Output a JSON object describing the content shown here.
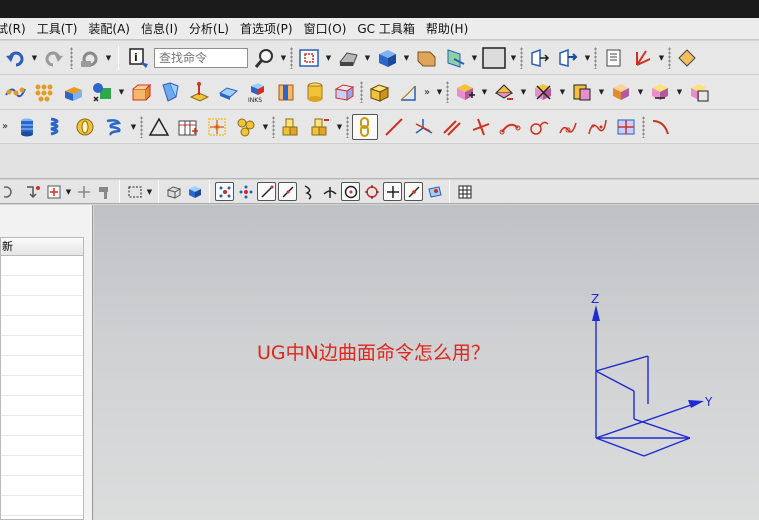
{
  "menu": {
    "items": [
      {
        "label": "试(R)"
      },
      {
        "label": "工具(T)"
      },
      {
        "label": "装配(A)"
      },
      {
        "label": "信息(I)"
      },
      {
        "label": "分析(L)"
      },
      {
        "label": "首选项(P)"
      },
      {
        "label": "窗口(O)"
      },
      {
        "label": "GC 工具箱"
      },
      {
        "label": "帮助(H)"
      }
    ]
  },
  "toolbar": {
    "search_placeholder": "查找命令"
  },
  "navigator": {
    "column_header": "新"
  },
  "viewport": {
    "caption": "UG中N边曲面命令怎么用？",
    "axis_z": "Z",
    "axis_y": "Y"
  },
  "colors": {
    "caption": "#e0261b",
    "triad": "#1f2ad1",
    "titlebar": "#1b1b1b"
  }
}
